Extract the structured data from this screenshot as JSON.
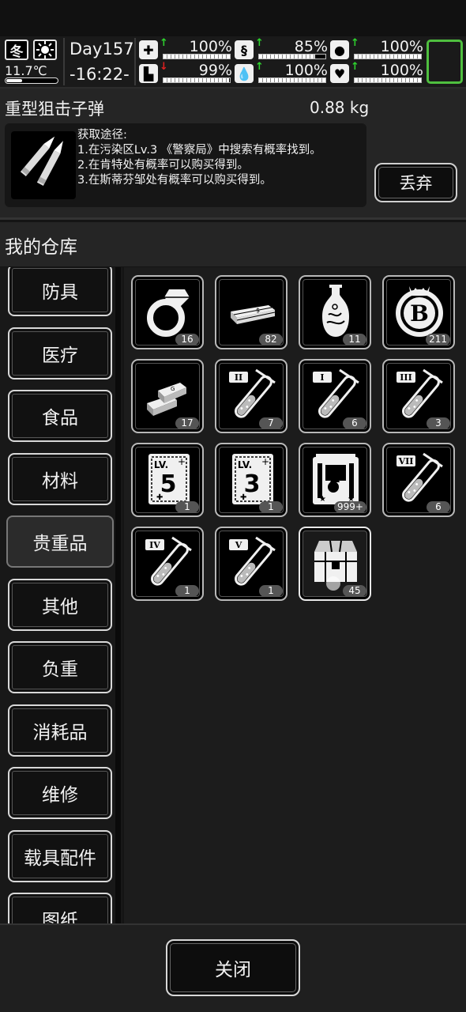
{
  "status": {
    "season": "冬",
    "weather_icon": "sun-icon",
    "temperature": "11.7℃",
    "day": "Day157",
    "clock": "-16:22-",
    "stats": [
      {
        "name": "health",
        "icon": "medkit-icon",
        "trend": "up",
        "percent": "100%",
        "level": 1.0
      },
      {
        "name": "hunger",
        "icon": "stomach-icon",
        "trend": "up",
        "percent": "85%",
        "level": 0.85
      },
      {
        "name": "medicine",
        "icon": "pill-icon",
        "trend": "up",
        "percent": "100%",
        "level": 1.0
      },
      {
        "name": "stamina",
        "icon": "boot-icon",
        "trend": "down",
        "percent": "99%",
        "level": 0.99
      },
      {
        "name": "thirst",
        "icon": "water-drop-icon",
        "trend": "up",
        "percent": "100%",
        "level": 1.0
      },
      {
        "name": "mood",
        "icon": "heart-icon",
        "trend": "up",
        "percent": "100%",
        "level": 1.0
      }
    ],
    "colors": {
      "up": "#2ed52e",
      "down": "#e02020",
      "accent": "#4fbf3f"
    }
  },
  "detail": {
    "name": "重型狙击子弹",
    "weight": "0.88 kg",
    "source_title": "获取途径:",
    "source_lines": [
      "1.在污染区Lv.3 《警察局》中搜索有概率找到。",
      "2.在肯特处有概率可以购买得到。",
      "3.在斯蒂芬邹处有概率可以购买得到。"
    ],
    "discard_label": "丢弃"
  },
  "warehouse": {
    "title": "我的仓库",
    "categories": [
      "防具",
      "医疗",
      "食品",
      "材料",
      "贵重品",
      "其他",
      "负重",
      "消耗品",
      "维修",
      "载具配件",
      "图纸"
    ],
    "active_category": "贵重品",
    "items": [
      {
        "icon": "ring-icon",
        "count": "16"
      },
      {
        "icon": "cash-stack-icon",
        "count": "82"
      },
      {
        "icon": "vase-icon",
        "count": "11"
      },
      {
        "icon": "bitcoin-icon",
        "count": "211"
      },
      {
        "icon": "gold-bars-icon",
        "count": "17"
      },
      {
        "icon": "potion-tube-ii-icon",
        "count": "7"
      },
      {
        "icon": "potion-tube-i-icon",
        "count": "6"
      },
      {
        "icon": "potion-tube-iii-icon",
        "count": "3"
      },
      {
        "icon": "skill-book-lv5-icon",
        "count": "1"
      },
      {
        "icon": "skill-book-lv3-icon",
        "count": "1"
      },
      {
        "icon": "dice-card-icon",
        "count": "999+"
      },
      {
        "icon": "potion-tube-vii-icon",
        "count": "6"
      },
      {
        "icon": "potion-tube-iv-icon",
        "count": "1"
      },
      {
        "icon": "potion-tube-v-icon",
        "count": "1"
      },
      {
        "icon": "treasure-chest-icon",
        "count": "45"
      }
    ],
    "tube_labels": [
      "II",
      "I",
      "III",
      "VII",
      "IV",
      "V"
    ],
    "book_labels": [
      "LV.",
      "5",
      "LV.",
      "3"
    ]
  },
  "close_label": "关闭"
}
